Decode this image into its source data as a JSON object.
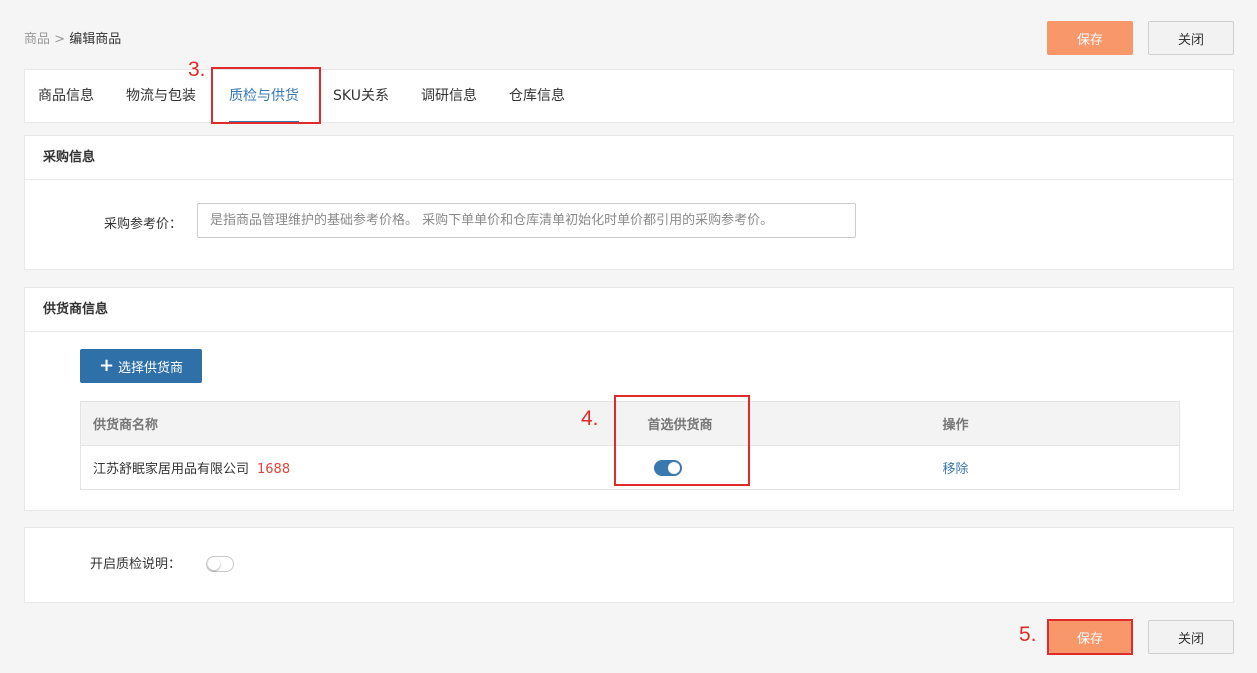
{
  "breadcrumb": {
    "parent": "商品",
    "separator": ">",
    "current": "编辑商品"
  },
  "header_actions": {
    "save_label": "保存",
    "close_label": "关闭"
  },
  "tabs": [
    {
      "label": "商品信息",
      "active": false
    },
    {
      "label": "物流与包装",
      "active": false
    },
    {
      "label": "质检与供货",
      "active": true
    },
    {
      "label": "SKU关系",
      "active": false
    },
    {
      "label": "调研信息",
      "active": false
    },
    {
      "label": "仓库信息",
      "active": false
    }
  ],
  "purchase": {
    "title": "采购信息",
    "ref_price_label": "采购参考价：",
    "ref_price_placeholder": "是指商品管理维护的基础参考价格。 采购下单单价和仓库清单初始化时单价都引用的采购参考价。",
    "ref_price_value": ""
  },
  "supplier": {
    "title": "供货商信息",
    "select_button": "选择供货商",
    "columns": [
      "供货商名称",
      "首选供货商",
      "操作"
    ],
    "rows": [
      {
        "name": "江苏舒眠家居用品有限公司",
        "tag": "1688",
        "preferred": true,
        "action": "移除"
      }
    ]
  },
  "quality": {
    "label": "开启质检说明：",
    "enabled": false
  },
  "footer_actions": {
    "save_label": "保存",
    "close_label": "关闭"
  },
  "annotations": {
    "step3": "3.",
    "step4": "4.",
    "step5": "5."
  },
  "colors": {
    "accent": "#3a78b0",
    "save": "#f7976a",
    "primary_button": "#2f70a9",
    "annotation": "#e02b2b",
    "tag_1688": "#e0463a"
  }
}
